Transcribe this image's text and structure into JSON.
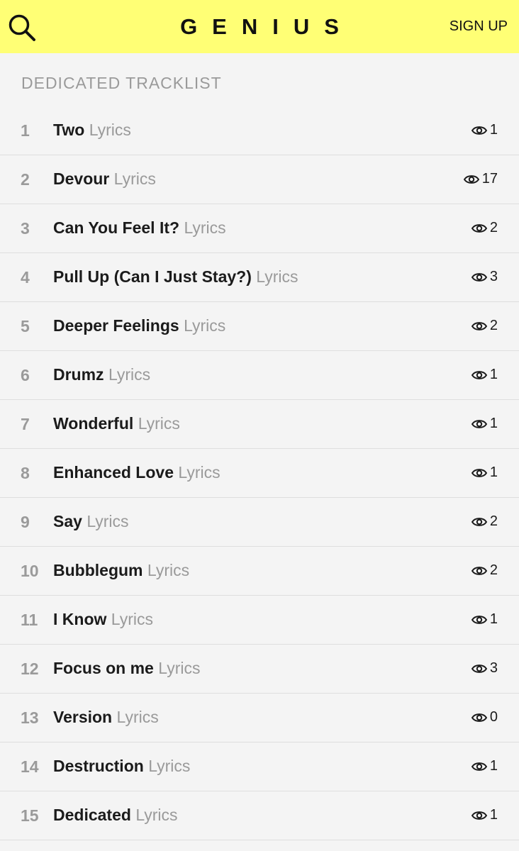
{
  "header": {
    "logo": "GENIUS",
    "signup_label": "SIGN UP",
    "search_icon": "search-icon",
    "background": "#ffff75"
  },
  "section_title": "DEDICATED TRACKLIST",
  "tracks": [
    {
      "num": "1",
      "title": "Two",
      "suffix": "Lyrics",
      "views": "1"
    },
    {
      "num": "2",
      "title": "Devour",
      "suffix": "Lyrics",
      "views": "17"
    },
    {
      "num": "3",
      "title": "Can You Feel It?",
      "suffix": "Lyrics",
      "views": "2"
    },
    {
      "num": "4",
      "title": "Pull Up (Can I Just Stay?)",
      "suffix": "Lyrics",
      "views": "3"
    },
    {
      "num": "5",
      "title": "Deeper Feelings",
      "suffix": "Lyrics",
      "views": "2"
    },
    {
      "num": "6",
      "title": "Drumz",
      "suffix": "Lyrics",
      "views": "1"
    },
    {
      "num": "7",
      "title": "Wonderful",
      "suffix": "Lyrics",
      "views": "1"
    },
    {
      "num": "8",
      "title": "Enhanced Love",
      "suffix": "Lyrics",
      "views": "1"
    },
    {
      "num": "9",
      "title": "Say",
      "suffix": "Lyrics",
      "views": "2"
    },
    {
      "num": "10",
      "title": "Bubblegum",
      "suffix": "Lyrics",
      "views": "2"
    },
    {
      "num": "11",
      "title": "I Know",
      "suffix": "Lyrics",
      "views": "1"
    },
    {
      "num": "12",
      "title": "Focus on me",
      "suffix": "Lyrics",
      "views": "3"
    },
    {
      "num": "13",
      "title": "Version",
      "suffix": "Lyrics",
      "views": "0"
    },
    {
      "num": "14",
      "title": "Destruction",
      "suffix": "Lyrics",
      "views": "1"
    },
    {
      "num": "15",
      "title": "Dedicated",
      "suffix": "Lyrics",
      "views": "1"
    }
  ]
}
